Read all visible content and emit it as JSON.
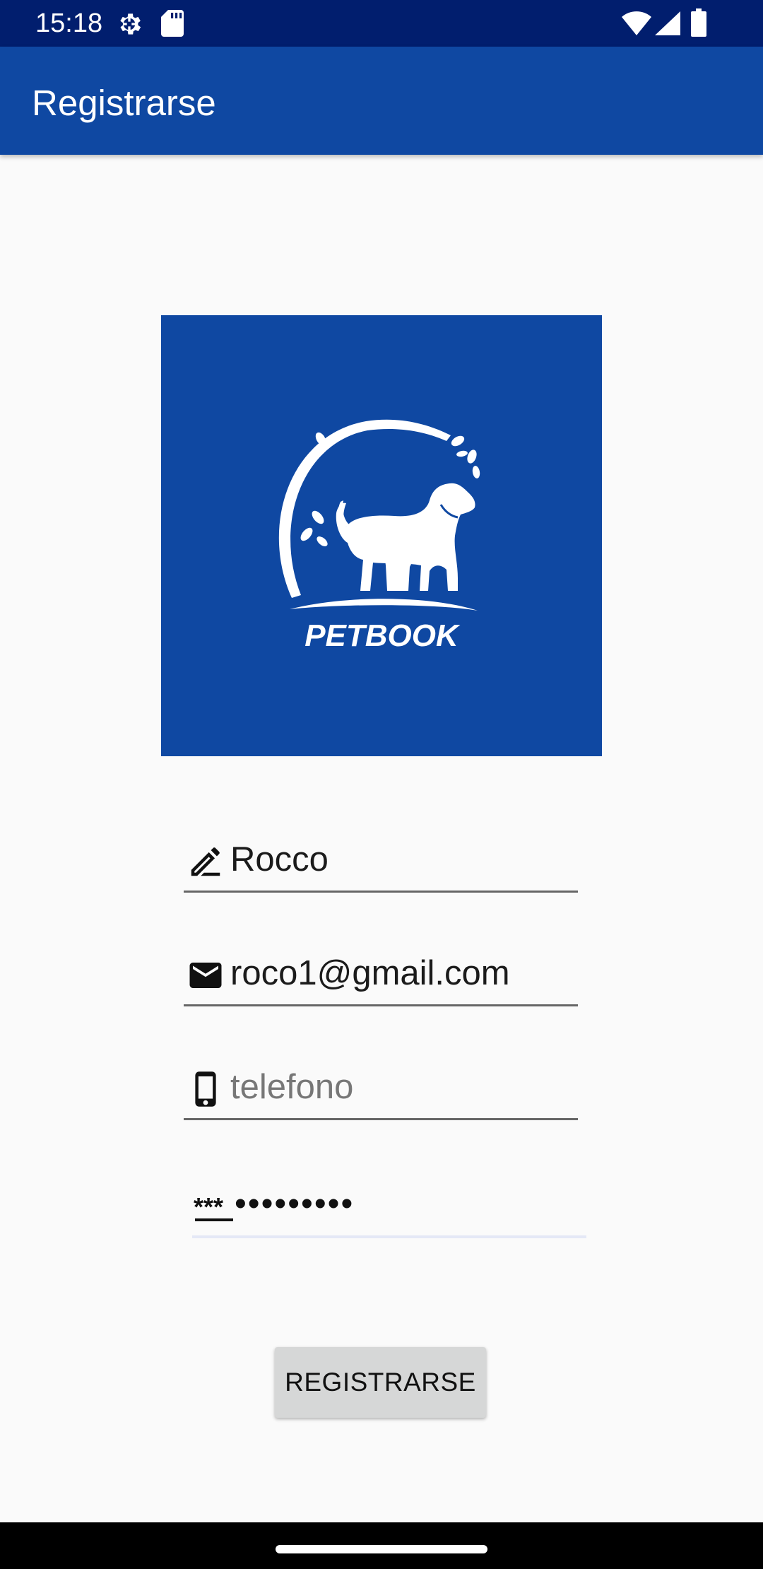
{
  "status_bar": {
    "time": "15:18",
    "icons": [
      "settings-icon",
      "sd-card-icon",
      "wifi-icon",
      "signal-icon",
      "battery-icon"
    ]
  },
  "app_bar": {
    "title": "Registrarse"
  },
  "logo": {
    "text": "PETBOOK"
  },
  "form": {
    "name": {
      "value": "Rocco",
      "icon": "edit-pencil-icon"
    },
    "email": {
      "value": "roco1@gmail.com",
      "icon": "mail-icon"
    },
    "phone": {
      "placeholder": "telefono",
      "icon": "smartphone-icon"
    },
    "password": {
      "value": "•••••••••",
      "icon": "password-icon"
    }
  },
  "register_button": {
    "label": "REGISTRARSE"
  },
  "colors": {
    "status_bar": "#011e6e",
    "primary": "#0f48a2",
    "background": "#fafafa",
    "button": "#d6d7d7"
  }
}
